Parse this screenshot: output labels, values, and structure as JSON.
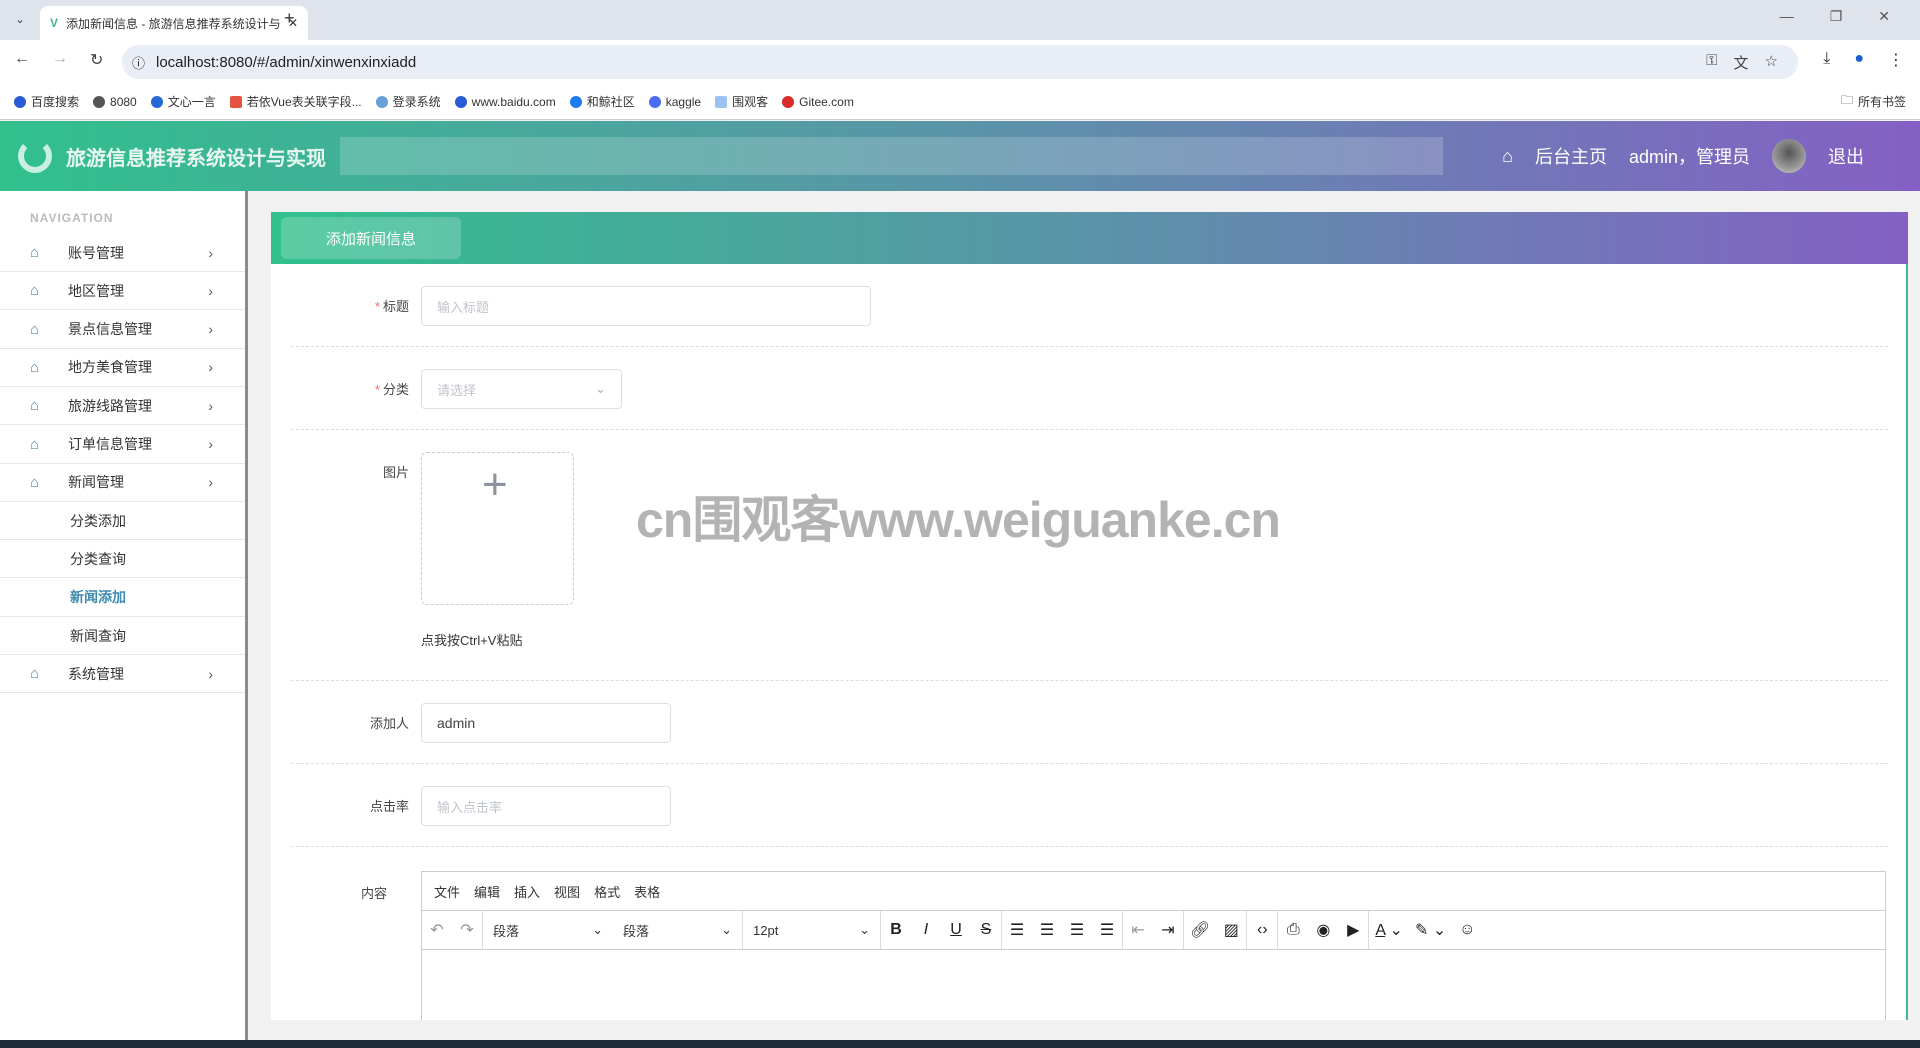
{
  "browser": {
    "tab_title": "添加新闻信息 - 旅游信息推荐系统设计与实现",
    "url": "localhost:8080/#/admin/xinwenxinxiadd",
    "bookmarks": [
      "百度搜索",
      "8080",
      "文心一言",
      "若依Vue表关联字段...",
      "登录系统",
      "www.baidu.com",
      "和鲸社区",
      "kaggle",
      "围观客",
      "Gitee.com"
    ],
    "all_bookmarks": "所有书签"
  },
  "header": {
    "title": "旅游信息推荐系统设计与实现",
    "home": "后台主页",
    "user": "admin，管理员",
    "logout": "退出"
  },
  "sidebar": {
    "heading": "NAVIGATION",
    "items": [
      {
        "label": "账号管理",
        "type": "group"
      },
      {
        "label": "地区管理",
        "type": "group"
      },
      {
        "label": "景点信息管理",
        "type": "group"
      },
      {
        "label": "地方美食管理",
        "type": "group"
      },
      {
        "label": "旅游线路管理",
        "type": "group"
      },
      {
        "label": "订单信息管理",
        "type": "group"
      },
      {
        "label": "新闻管理",
        "type": "group"
      },
      {
        "label": "分类添加",
        "type": "sub"
      },
      {
        "label": "分类查询",
        "type": "sub"
      },
      {
        "label": "新闻添加",
        "type": "sub",
        "active": true
      },
      {
        "label": "新闻查询",
        "type": "sub"
      },
      {
        "label": "系统管理",
        "type": "group"
      }
    ]
  },
  "form": {
    "card_title": "添加新闻信息",
    "title": {
      "label": "标题",
      "placeholder": "输入标题"
    },
    "category": {
      "label": "分类",
      "placeholder": "请选择"
    },
    "image": {
      "label": "图片",
      "paste_hint": "点我按Ctrl+V粘贴"
    },
    "adder": {
      "label": "添加人",
      "value": "admin"
    },
    "clicks": {
      "label": "点击率",
      "placeholder": "输入点击率"
    },
    "content": {
      "label": "内容"
    }
  },
  "editor": {
    "menu": [
      "文件",
      "编辑",
      "插入",
      "视图",
      "格式",
      "表格"
    ],
    "block_format": "段落",
    "font_family": "段落",
    "font_size": "12pt"
  },
  "watermark": "cn围观客www.weiguanke.cn"
}
